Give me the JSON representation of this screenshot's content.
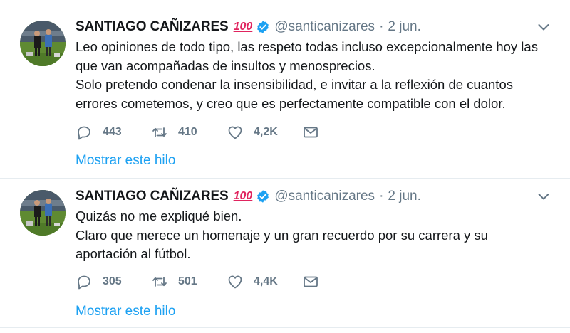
{
  "tweets": [
    {
      "author_name": "SANTIAGO CAÑIZARES",
      "emoji": "100",
      "handle": "@santicanizares",
      "dot": "·",
      "time": "2 jun.",
      "text_lines": [
        "Leo opiniones de todo tipo, las respeto todas incluso excepcionalmente hoy las que van acompañadas de insultos y menosprecios.",
        "Solo pretendo condenar la insensibilidad, e invitar a la reflexión de cuantos errores cometemos, y creo que es perfectamente compatible con el dolor."
      ],
      "replies": "443",
      "retweets": "410",
      "likes": "4,2K",
      "thread_link": "Mostrar este hilo"
    },
    {
      "author_name": "SANTIAGO CAÑIZARES",
      "emoji": "100",
      "handle": "@santicanizares",
      "dot": "·",
      "time": "2 jun.",
      "text_lines": [
        "Quizás no me expliqué bien.",
        "Claro que merece un homenaje y un gran recuerdo por su carrera y su aportación al fútbol."
      ],
      "replies": "305",
      "retweets": "501",
      "likes": "4,4K",
      "thread_link": "Mostrar este hilo"
    }
  ],
  "icons": {
    "verified": "verified-badge-icon",
    "caret": "chevron-down-icon",
    "reply": "reply-icon",
    "retweet": "retweet-icon",
    "like": "heart-icon",
    "dm": "envelope-icon"
  },
  "colors": {
    "text": "#14171a",
    "muted": "#657786",
    "link": "#1da1f2",
    "verified": "#1da1f2",
    "emoji": "#e0245e",
    "border": "#e6ecf0"
  }
}
